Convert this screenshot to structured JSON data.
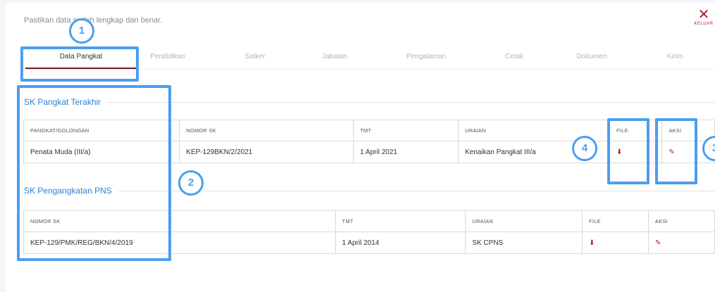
{
  "notice": "Pastikan data sudah lengkap dan benar.",
  "exit": {
    "icon": "close-icon",
    "label": "KELUAR"
  },
  "tabs": [
    {
      "label": "Data Pangkat"
    },
    {
      "label": "Pendidikan"
    },
    {
      "label": "Satker"
    },
    {
      "label": "Jabatan"
    },
    {
      "label": "Pengalaman"
    },
    {
      "label": "Cetak"
    },
    {
      "label": "Dokumen"
    },
    {
      "label": "Kirim"
    }
  ],
  "sk_pangkat": {
    "title": "SK Pangkat Terakhir",
    "headers": [
      "PANGKAT/GOLONGAN",
      "NOMOR SK",
      "TMT",
      "URAIAN",
      "FILE",
      "AKSI"
    ],
    "row": {
      "pangkat": "Penata Muda (III/a)",
      "nomor": "KEP-129BKN/2/2021",
      "tmt": "1 April 2021",
      "uraian": "Kenaikan Pangkat III/a"
    }
  },
  "sk_pns": {
    "title": "SK Pengangkatan PNS",
    "headers": [
      "NOMOR SK",
      "TMT",
      "URAIAN",
      "FILE",
      "AKSI"
    ],
    "row": {
      "nomor": "KEP-129/PMK/REG/BKN/4/2019",
      "tmt": "1 April 2014",
      "uraian": "SK CPNS"
    }
  },
  "badges": [
    "1",
    "2",
    "3",
    "4"
  ],
  "colors": {
    "accent": "#b01e23",
    "link": "#2f7fd1",
    "highlight": "#4b9ef0"
  }
}
